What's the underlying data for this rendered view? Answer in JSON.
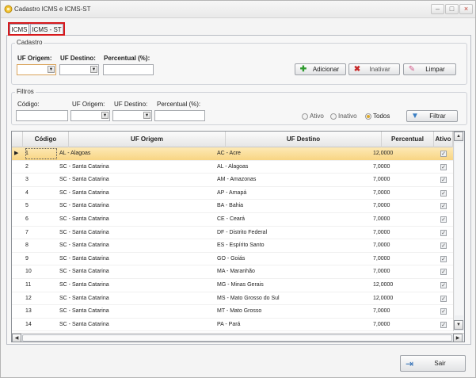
{
  "window": {
    "title": "Cadastro ICMS e ICMS-ST",
    "minimize": "–",
    "maximize": "□",
    "close": "×"
  },
  "tabs": [
    {
      "label": "ICMS"
    },
    {
      "label": "ICMS - ST"
    }
  ],
  "cadastro": {
    "legend": "Cadastro",
    "uf_origem_label": "UF Origem:",
    "uf_destino_label": "UF Destino:",
    "percentual_label": "Percentual (%):",
    "uf_origem_value": "",
    "uf_destino_value": "",
    "percentual_value": "",
    "buttons": {
      "adicionar": "Adicionar",
      "inativar": "Inativar",
      "limpar": "Limpar"
    }
  },
  "filtros": {
    "legend": "Filtros",
    "codigo_label": "Código:",
    "uf_origem_label": "UF Origem:",
    "uf_destino_label": "UF Destino:",
    "percentual_label": "Percentual (%):",
    "radio_ativo": "Ativo",
    "radio_inativo": "Inativo",
    "radio_todos": "Todos",
    "selected_radio": "Todos",
    "filtrar_button": "Filtrar"
  },
  "grid": {
    "columns": [
      "Código",
      "UF Origem",
      "UF Destino",
      "Percentual",
      "Ativo"
    ],
    "rows": [
      {
        "codigo": "1",
        "origem": "AL - Alagoas",
        "destino": "AC - Acre",
        "percentual": "12,0000",
        "ativo": true
      },
      {
        "codigo": "2",
        "origem": "SC - Santa Catarina",
        "destino": "AL - Alagoas",
        "percentual": "7,0000",
        "ativo": true
      },
      {
        "codigo": "3",
        "origem": "SC - Santa Catarina",
        "destino": "AM - Amazonas",
        "percentual": "7,0000",
        "ativo": true
      },
      {
        "codigo": "4",
        "origem": "SC - Santa Catarina",
        "destino": "AP - Amapá",
        "percentual": "7,0000",
        "ativo": true
      },
      {
        "codigo": "5",
        "origem": "SC - Santa Catarina",
        "destino": "BA - Bahia",
        "percentual": "7,0000",
        "ativo": true
      },
      {
        "codigo": "6",
        "origem": "SC - Santa Catarina",
        "destino": "CE - Ceará",
        "percentual": "7,0000",
        "ativo": true
      },
      {
        "codigo": "7",
        "origem": "SC - Santa Catarina",
        "destino": "DF - Distrito Federal",
        "percentual": "7,0000",
        "ativo": true
      },
      {
        "codigo": "8",
        "origem": "SC - Santa Catarina",
        "destino": "ES - Espírito Santo",
        "percentual": "7,0000",
        "ativo": true
      },
      {
        "codigo": "9",
        "origem": "SC - Santa Catarina",
        "destino": "GO - Goiás",
        "percentual": "7,0000",
        "ativo": true
      },
      {
        "codigo": "10",
        "origem": "SC - Santa Catarina",
        "destino": "MA - Maranhão",
        "percentual": "7,0000",
        "ativo": true
      },
      {
        "codigo": "11",
        "origem": "SC - Santa Catarina",
        "destino": "MG - Minas Gerais",
        "percentual": "12,0000",
        "ativo": true
      },
      {
        "codigo": "12",
        "origem": "SC - Santa Catarina",
        "destino": "MS - Mato Grosso do Sul",
        "percentual": "12,0000",
        "ativo": true
      },
      {
        "codigo": "13",
        "origem": "SC - Santa Catarina",
        "destino": "MT - Mato Grosso",
        "percentual": "7,0000",
        "ativo": true
      },
      {
        "codigo": "14",
        "origem": "SC - Santa Catarina",
        "destino": "PA - Pará",
        "percentual": "7,0000",
        "ativo": true
      }
    ],
    "selected_row": "1"
  },
  "footer": {
    "sair_button": "Sair"
  },
  "icons": {
    "adicionar": "plus-icon",
    "inativar": "x-icon",
    "limpar": "eraser-icon",
    "filtrar": "filter-icon",
    "sair": "exit-door-icon"
  },
  "colors": {
    "selected_row": "#f8d583",
    "highlight_border": "#d7191c",
    "add_green": "#2e9a2e",
    "x_red": "#c62828"
  }
}
